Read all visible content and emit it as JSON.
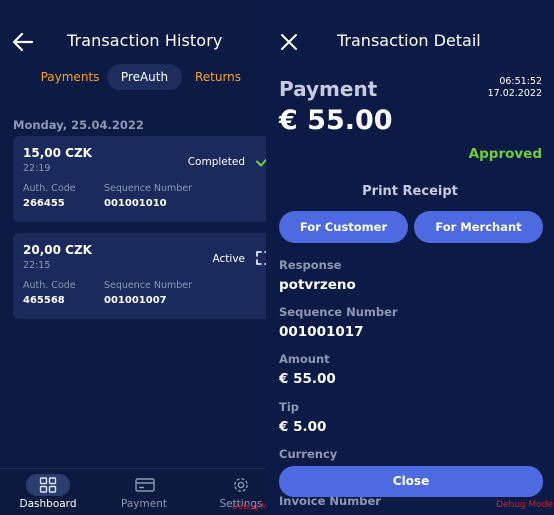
{
  "history": {
    "title": "Transaction History",
    "tabs": {
      "payments": "Payments",
      "preauth": "PreAuth",
      "returns": "Returns",
      "active": "PreAuth"
    },
    "date_header": "Monday, 25.04.2022",
    "transactions": [
      {
        "amount": "15,00 CZK",
        "time": "22:19",
        "status": "Completed",
        "status_icon": "check-icon",
        "auth_code_label": "Auth. Code",
        "auth_code": "266455",
        "sequence_label": "Sequence Number",
        "sequence": "001001010"
      },
      {
        "amount": "20,00 CZK",
        "time": "22:15",
        "status": "Active",
        "status_icon": "expand-icon",
        "auth_code_label": "Auth. Code",
        "auth_code": "465568",
        "sequence_label": "Sequence Number",
        "sequence": "001001007"
      }
    ],
    "nav": {
      "dashboard": "Dashboard",
      "payment": "Payment",
      "settings": "Settings"
    },
    "debug_text": "Debug M"
  },
  "detail": {
    "title": "Transaction Detail",
    "type": "Payment",
    "time": "06:51:52",
    "date": "17.02.2022",
    "amount": "€ 55.00",
    "status": "Approved",
    "print_receipt": "Print Receipt",
    "buttons": {
      "customer": "For Customer",
      "merchant": "For Merchant",
      "close": "Close"
    },
    "fields": [
      {
        "label": "Response",
        "value": "potvrzeno"
      },
      {
        "label": "Sequence Number",
        "value": "001001017"
      },
      {
        "label": "Amount",
        "value": "€ 55.00"
      },
      {
        "label": "Tip",
        "value": "€ 5.00"
      },
      {
        "label": "Currency",
        "value": ""
      },
      {
        "label": "Invoice Number",
        "value": ""
      }
    ],
    "debug_text": "Debug Mode"
  },
  "colors": {
    "background": "#0c1b45",
    "card": "#1a2a5c",
    "accent_orange": "#f5a22a",
    "accent_green": "#6fce3a",
    "button_blue": "#4d6ae0",
    "debug_red": "#d21f2a"
  }
}
